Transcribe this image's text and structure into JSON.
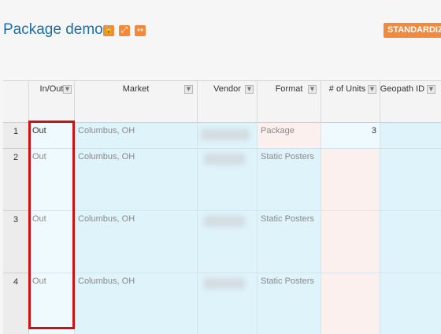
{
  "header": {
    "title": "Package demo",
    "icons": [
      "lock-open-icon",
      "expand-icon",
      "resize-horizontal-icon"
    ],
    "standardize_label": "STANDARDIZE"
  },
  "grid": {
    "columns": [
      {
        "label": "In/Out"
      },
      {
        "label": "Market"
      },
      {
        "label": "Vendor"
      },
      {
        "label": "Format"
      },
      {
        "label": "# of Units"
      },
      {
        "label": "Geopath ID #"
      }
    ],
    "rows": [
      {
        "num": "1",
        "inout": "Out",
        "market": "Columbus, OH",
        "format": "Package",
        "units": "3"
      },
      {
        "num": "2",
        "inout": "Out",
        "market": "Columbus, OH",
        "format": "Static Posters",
        "units": ""
      },
      {
        "num": "3",
        "inout": "Out",
        "market": "Columbus, OH",
        "format": "Static Posters",
        "units": ""
      },
      {
        "num": "4",
        "inout": "Out",
        "market": "Columbus, OH",
        "format": "Static Posters",
        "units": ""
      }
    ]
  },
  "colors": {
    "accent": "#f28a3d",
    "title": "#1d6fa8",
    "highlight": "#cc1111",
    "cell_blue": "#dff3fa",
    "cell_pink": "#fcf0ee"
  }
}
